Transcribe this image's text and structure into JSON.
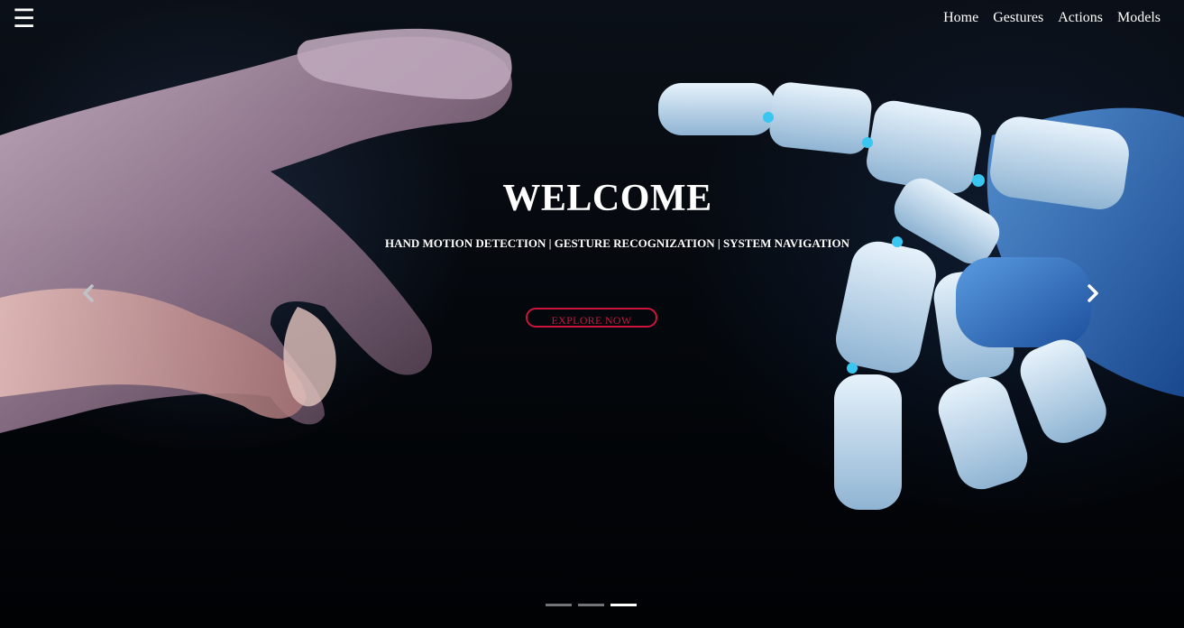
{
  "nav": {
    "menu_icon": "hamburger-menu-icon",
    "links": [
      "Home",
      "Gestures",
      "Actions",
      "Models"
    ]
  },
  "hero": {
    "title": "WELCOME",
    "subtitle": "HAND MOTION DETECTION | GESTURE RECOGNIZATION | SYSTEM NAVIGATION",
    "cta_label": "EXPLORE NOW",
    "cta_color": "#c8163e",
    "image": "human hand reaching toward a white-and-blue robotic hand on a dark background"
  },
  "carousel": {
    "prev_icon": "chevron-left-icon",
    "next_icon": "chevron-right-icon",
    "slide_count": 3,
    "active_slide": 3
  }
}
